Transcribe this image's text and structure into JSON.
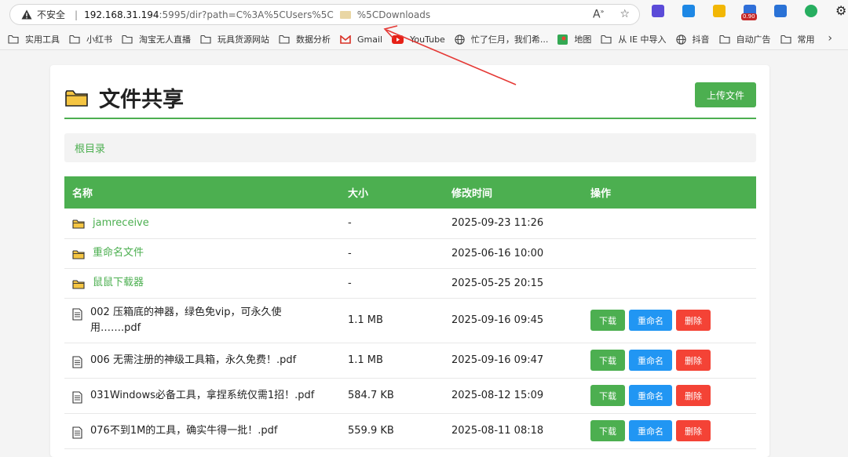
{
  "browser": {
    "insecure_label": "不安全",
    "url_host": "192.168.31.194",
    "url_path": ":5995/dir?path=C%3A%5CUsers%5C",
    "url_tail": "%5CDownloads",
    "ext_badge": "0.90",
    "bookmarks": [
      {
        "label": "实用工具",
        "icon": "folder-icon"
      },
      {
        "label": "小红书",
        "icon": "folder-icon"
      },
      {
        "label": "淘宝无人直播",
        "icon": "folder-icon"
      },
      {
        "label": "玩具货源网站",
        "icon": "folder-icon"
      },
      {
        "label": "数据分析",
        "icon": "folder-icon"
      },
      {
        "label": "Gmail",
        "icon": "gmail-icon"
      },
      {
        "label": "YouTube",
        "icon": "youtube-icon"
      },
      {
        "label": "忙了仨月，我们希...",
        "icon": "globe-icon"
      },
      {
        "label": "地图",
        "icon": "maps-icon"
      },
      {
        "label": "从 IE 中导入",
        "icon": "folder-icon"
      },
      {
        "label": "抖音",
        "icon": "globe-icon"
      },
      {
        "label": "自动广告",
        "icon": "folder-icon"
      },
      {
        "label": "常用",
        "icon": "folder-icon"
      }
    ]
  },
  "page": {
    "title": "文件共享",
    "upload_label": "上传文件",
    "breadcrumb": "根目录",
    "columns": [
      "名称",
      "大小",
      "修改时间",
      "操作"
    ],
    "dirs": [
      {
        "name": "jamreceive",
        "size": "-",
        "modified": "2025-09-23 11:26"
      },
      {
        "name": "重命名文件",
        "size": "-",
        "modified": "2025-06-16 10:00"
      },
      {
        "name": "鼠鼠下载器",
        "size": "-",
        "modified": "2025-05-25 20:15"
      }
    ],
    "files": [
      {
        "name": "002 压箱底的神器，绿色免vip，可永久使用…….pdf",
        "size": "1.1 MB",
        "modified": "2025-09-16 09:45"
      },
      {
        "name": "006 无需注册的神级工具箱，永久免费！.pdf",
        "size": "1.1 MB",
        "modified": "2025-09-16 09:47"
      },
      {
        "name": "031Windows必备工具，拿捏系统仅需1招！.pdf",
        "size": "584.7 KB",
        "modified": "2025-08-12 15:09"
      },
      {
        "name": "076不到1M的工具，确实牛得一批！.pdf",
        "size": "559.9 KB",
        "modified": "2025-08-11 08:18"
      }
    ],
    "actions": {
      "download": "下载",
      "rename": "重命名",
      "delete": "删除"
    }
  },
  "colors": {
    "accent": "#4caf50",
    "rename": "#2196f3",
    "delete": "#f44336",
    "annotation": "#e53935"
  }
}
